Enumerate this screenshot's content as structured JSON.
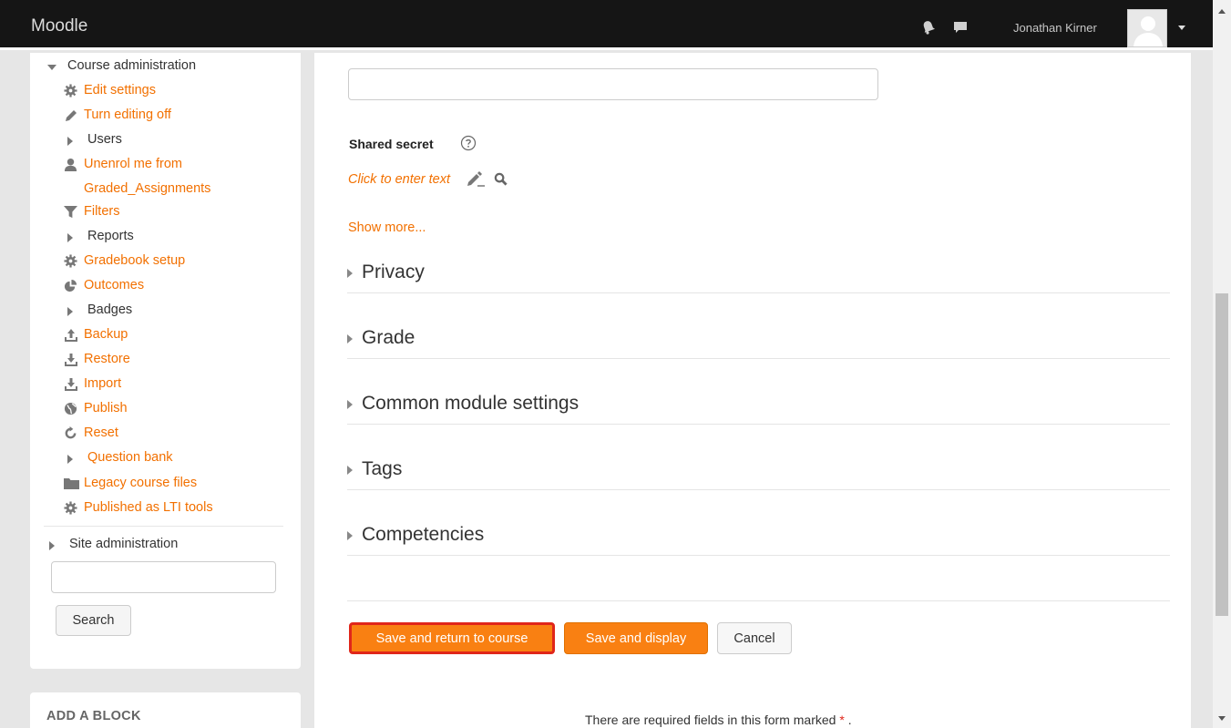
{
  "navbar": {
    "brand": "Moodle",
    "username": "Jonathan Kirner",
    "icons": [
      "bell-icon",
      "chat-icon"
    ]
  },
  "sidebar": {
    "items": [
      {
        "label": "Course administration",
        "type": "expanded"
      },
      {
        "label": "Edit settings",
        "icon": "gear-icon"
      },
      {
        "label": "Turn editing off",
        "icon": "pencil-icon"
      },
      {
        "label": "Users",
        "type": "collapsed"
      },
      {
        "label": "Unenrol me from",
        "label2": "Graded_Assignments",
        "icon": "user-icon"
      },
      {
        "label": "Filters",
        "icon": "filter-icon"
      },
      {
        "label": "Reports",
        "type": "collapsed"
      },
      {
        "label": "Gradebook setup",
        "icon": "gear-icon"
      },
      {
        "label": "Outcomes",
        "icon": "pie-icon"
      },
      {
        "label": "Badges",
        "type": "collapsed"
      },
      {
        "label": "Backup",
        "icon": "upload-icon"
      },
      {
        "label": "Restore",
        "icon": "download-icon"
      },
      {
        "label": "Import",
        "icon": "download-icon"
      },
      {
        "label": "Publish",
        "icon": "globe-icon"
      },
      {
        "label": "Reset",
        "icon": "refresh-icon"
      },
      {
        "label": "Question bank",
        "type": "collapsed"
      },
      {
        "label": "Legacy course files",
        "icon": "folder-icon"
      },
      {
        "label": "Published as LTI tools",
        "icon": "gear-icon"
      }
    ],
    "site_admin": "Site administration",
    "search_placeholder": "",
    "search_button": "Search",
    "add_block": "ADD A BLOCK"
  },
  "form": {
    "input_value": "",
    "shared_secret_label": "Shared secret",
    "click_to_enter": "Click to enter text",
    "show_more": "Show more...",
    "sections": [
      "Privacy",
      "Grade",
      "Common module settings",
      "Tags",
      "Competencies"
    ],
    "buttons": {
      "save_return": "Save and return to course",
      "save_display": "Save and display",
      "cancel": "Cancel"
    },
    "required_note": "There are required fields in this form marked",
    "required_star": "*",
    "required_end": "."
  },
  "colors": {
    "accent": "#f98012",
    "link": "#f27000",
    "navbar": "#151515",
    "highlight_border": "#e0261a"
  }
}
